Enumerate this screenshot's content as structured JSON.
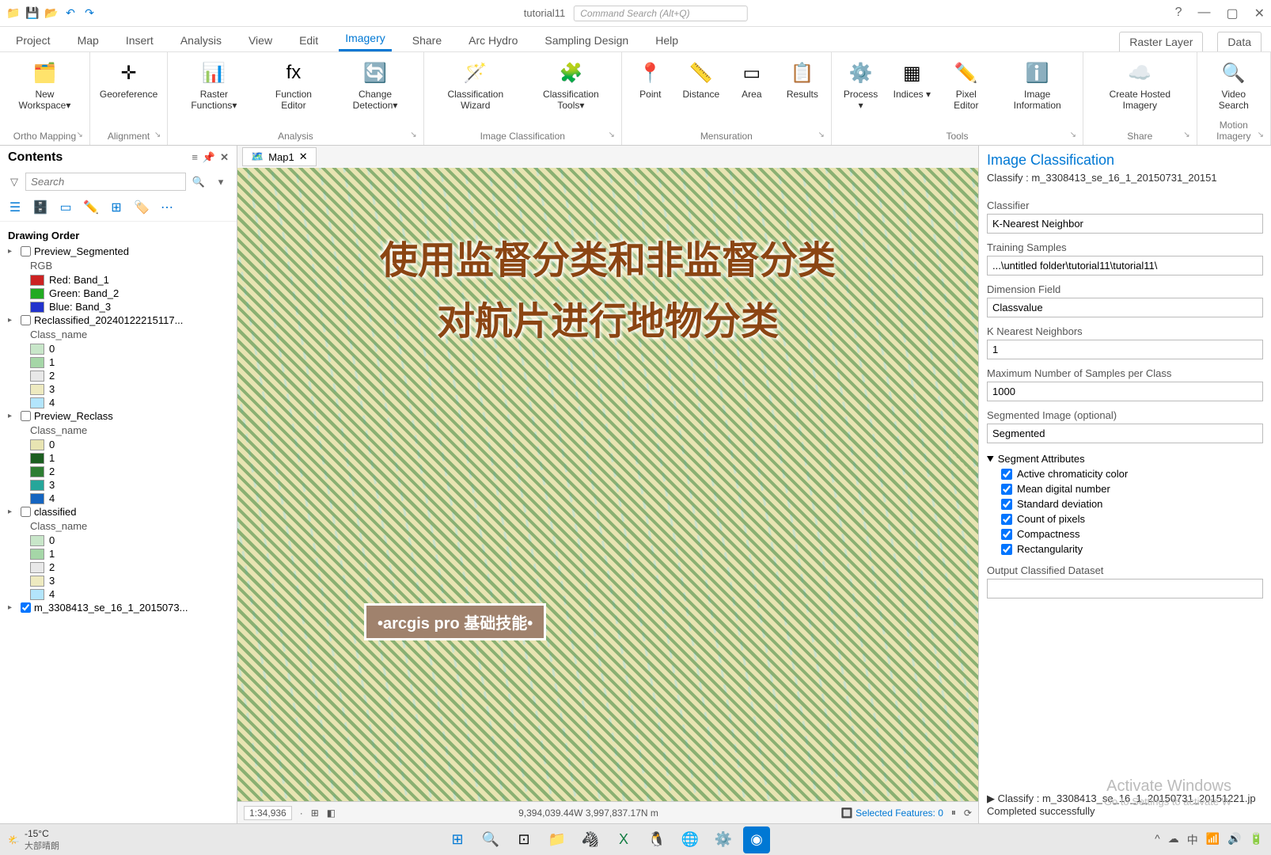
{
  "titlebar": {
    "app_title": "tutorial11",
    "cmd_search_placeholder": "Command Search (Alt+Q)"
  },
  "ribbon_tabs": [
    "Project",
    "Map",
    "Insert",
    "Analysis",
    "View",
    "Edit",
    "Imagery",
    "Share",
    "Arc Hydro",
    "Sampling Design",
    "Help"
  ],
  "ribbon_context_tabs": [
    "Raster Layer",
    "Data"
  ],
  "ribbon_active": "Imagery",
  "ribbon_groups": [
    {
      "label": "Ortho Mapping",
      "items": [
        {
          "label": "New\nWorkspace▾",
          "icon": "🗂️"
        }
      ]
    },
    {
      "label": "Alignment",
      "items": [
        {
          "label": "Georeference",
          "icon": "✛"
        }
      ]
    },
    {
      "label": "Analysis",
      "items": [
        {
          "label": "Raster\nFunctions▾",
          "icon": "📊"
        },
        {
          "label": "Function\nEditor",
          "icon": "fx"
        },
        {
          "label": "Change\nDetection▾",
          "icon": "🔄"
        }
      ]
    },
    {
      "label": "Image Classification",
      "items": [
        {
          "label": "Classification\nWizard",
          "icon": "🪄"
        },
        {
          "label": "Classification\nTools▾",
          "icon": "🧩"
        }
      ]
    },
    {
      "label": "Mensuration",
      "items": [
        {
          "label": "Point",
          "icon": "📍"
        },
        {
          "label": "Distance",
          "icon": "📏"
        },
        {
          "label": "Area",
          "icon": "▭"
        },
        {
          "label": "Results",
          "icon": "📋"
        }
      ]
    },
    {
      "label": "Tools",
      "items": [
        {
          "label": "Process\n▾",
          "icon": "⚙️"
        },
        {
          "label": "Indices\n▾",
          "icon": "▦"
        },
        {
          "label": "Pixel\nEditor",
          "icon": "✏️"
        },
        {
          "label": "Image\nInformation",
          "icon": "ℹ️"
        }
      ]
    },
    {
      "label": "Share",
      "items": [
        {
          "label": "Create Hosted\nImagery",
          "icon": "☁️"
        }
      ]
    },
    {
      "label": "Motion Imagery",
      "items": [
        {
          "label": "Video\nSearch",
          "icon": "🔍"
        }
      ]
    }
  ],
  "contents": {
    "title": "Contents",
    "search_placeholder": "Search",
    "drawing_order": "Drawing Order",
    "layers": [
      {
        "name": "Preview_Segmented",
        "rgbLabel": "RGB",
        "bands": [
          {
            "color": "#cc2222",
            "label": "Red: Band_1"
          },
          {
            "color": "#22aa22",
            "label": "Green: Band_2"
          },
          {
            "color": "#2233cc",
            "label": "Blue: Band_3"
          }
        ]
      },
      {
        "name": "Reclassified_20240122215117...",
        "field": "Class_name",
        "classes": [
          {
            "c": "#c8e6c9",
            "v": "0"
          },
          {
            "c": "#a5d6a7",
            "v": "1"
          },
          {
            "c": "#e8e8e8",
            "v": "2"
          },
          {
            "c": "#eeeac0",
            "v": "3"
          },
          {
            "c": "#b3e5fc",
            "v": "4"
          }
        ]
      },
      {
        "name": "Preview_Reclass",
        "field": "Class_name",
        "classes": [
          {
            "c": "#e8e4b2",
            "v": "0"
          },
          {
            "c": "#1b5e20",
            "v": "1"
          },
          {
            "c": "#2e7d32",
            "v": "2"
          },
          {
            "c": "#26a69a",
            "v": "3"
          },
          {
            "c": "#1565c0",
            "v": "4"
          }
        ]
      },
      {
        "name": "classified",
        "field": "Class_name",
        "classes": [
          {
            "c": "#c8e6c9",
            "v": "0"
          },
          {
            "c": "#a5d6a7",
            "v": "1"
          },
          {
            "c": "#e8e8e8",
            "v": "2"
          },
          {
            "c": "#eeeac0",
            "v": "3"
          },
          {
            "c": "#b3e5fc",
            "v": "4"
          }
        ]
      },
      {
        "name": "m_3308413_se_16_1_2015073...",
        "checked": true
      }
    ]
  },
  "map": {
    "tab_name": "Map1",
    "overlay_line1": "使用监督分类和非监督分类",
    "overlay_line2": "对航片进行地物分类",
    "badge": "•arcgis pro 基础技能•",
    "scale": "1:34,936",
    "coords": "9,394,039.44W 3,997,837.17N m",
    "selected": "Selected Features: 0"
  },
  "panel": {
    "title": "Image Classification",
    "subtitle": "Classify : m_3308413_se_16_1_20150731_20151",
    "classifier_label": "Classifier",
    "classifier_value": "K-Nearest Neighbor",
    "training_label": "Training Samples",
    "training_value": "...\\untitled folder\\tutorial11\\tutorial11\\",
    "dimension_label": "Dimension Field",
    "classvalue_label": "Classvalue",
    "knn_label": "K Nearest Neighbors",
    "knn_value": "1",
    "maxsamp_label": "Maximum Number of Samples per Class",
    "maxsamp_value": "1000",
    "segimg_label": "Segmented Image (optional)",
    "segimg_value": "Segmented",
    "segattr_title": "Segment Attributes",
    "segattrs": [
      "Active chromaticity color",
      "Mean digital number",
      "Standard deviation",
      "Count of pixels",
      "Compactness",
      "Rectangularity"
    ],
    "output_label": "Output Classified Dataset",
    "status_line1": "Classify : m_3308413_se_16_1_20150731_20151221.jp",
    "status_line2": "Completed successfully"
  },
  "activate": {
    "title": "Activate Windows",
    "sub": "Go to Settings to activate W"
  },
  "taskbar": {
    "temp": "-15°C",
    "desc": "大部晴朗"
  }
}
